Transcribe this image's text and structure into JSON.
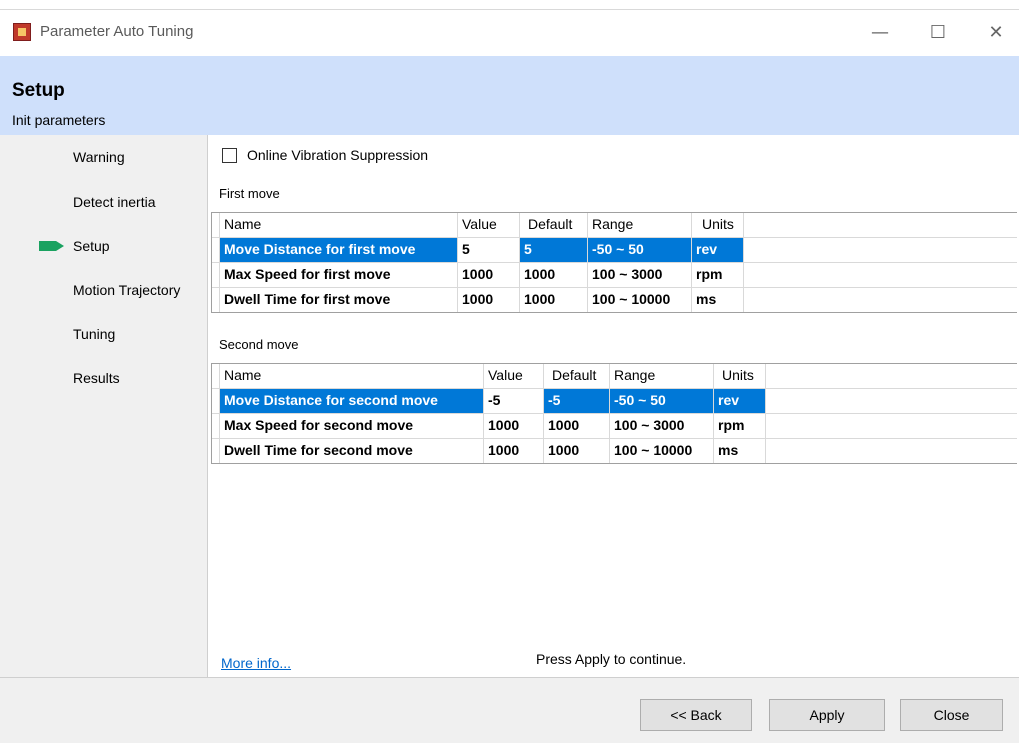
{
  "window": {
    "title": "Parameter Auto Tuning",
    "min_icon": "minimize-icon",
    "max_icon": "maximize-icon",
    "close_icon": "close-icon"
  },
  "header": {
    "title": "Setup",
    "subtitle": "Init parameters"
  },
  "nav": {
    "items": [
      "Warning",
      "Detect inertia",
      "Setup",
      "Motion Trajectory",
      "Tuning",
      "Results"
    ],
    "active_index": 2,
    "active_color": "#1aa260"
  },
  "options": {
    "online_vibration_label": "Online Vibration Suppression",
    "online_vibration_checked": false
  },
  "first_move": {
    "label": "First move",
    "columns": [
      "Name",
      "Value",
      "Default",
      "Range",
      "Units"
    ],
    "rows": [
      [
        "Move Distance for first move",
        "5",
        "5",
        "-50 ~ 50",
        "rev"
      ],
      [
        "Max Speed for first move",
        "1000",
        "1000",
        "100 ~ 3000",
        "rpm"
      ],
      [
        "Dwell Time for first move",
        "1000",
        "1000",
        "100 ~ 10000",
        "ms"
      ]
    ]
  },
  "second_move": {
    "label": "Second move",
    "columns": [
      "Name",
      "Value",
      "Default",
      "Range",
      "Units"
    ],
    "rows": [
      [
        "Move Distance for second move",
        "-5",
        "-5",
        "-50 ~ 50",
        "rev"
      ],
      [
        "Max Speed for second move",
        "1000",
        "1000",
        "100 ~ 3000",
        "rpm"
      ],
      [
        "Dwell Time for second move",
        "1000",
        "1000",
        "100 ~ 10000",
        "ms"
      ]
    ]
  },
  "footer": {
    "more_info": "More info...",
    "press_message": "Press Apply to continue.",
    "back": "<< Back",
    "apply": "Apply",
    "close": "Close"
  },
  "colors": {
    "header_band": "#cfe0fb",
    "selection": "#0078d7"
  }
}
